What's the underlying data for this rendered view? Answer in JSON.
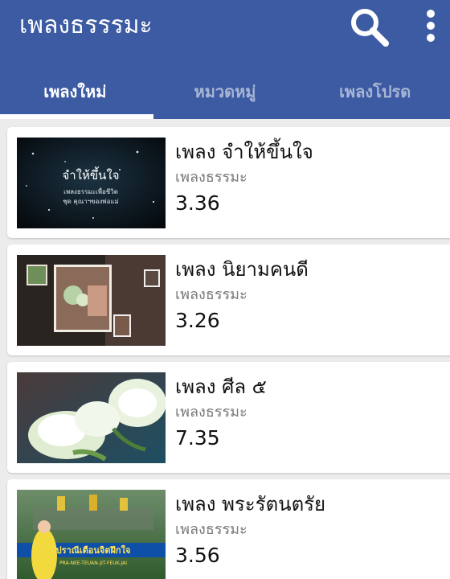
{
  "app": {
    "title": "เพลงธรรรมะ",
    "actions": [
      "search-icon",
      "more-vert-icon"
    ]
  },
  "colors": {
    "appbar": "#3c5ba2",
    "background": "#ececec",
    "card": "#ffffff"
  },
  "tabs": [
    {
      "label": "เพลงใหม่",
      "active": true
    },
    {
      "label": "หมวดหมู่",
      "active": false
    },
    {
      "label": "เพลงโปรด",
      "active": false
    }
  ],
  "songs": [
    {
      "title": "เพลง จำให้ขึ้นใจ",
      "category": "เพลงธรรมะ",
      "duration": "3.36",
      "thumbnail": {
        "title": "จำให้ขึ้นใจ",
        "line1": "เพลงธรรมะเพื่อชีวิต",
        "line2": "ชุด คุณาฯของพ่อแม่"
      }
    },
    {
      "title": "เพลง นิยามคนดี",
      "category": "เพลงธรรมะ",
      "duration": "3.26"
    },
    {
      "title": "เพลง ศีล ๕",
      "category": "เพลงธรรมะ",
      "duration": "7.35"
    },
    {
      "title": "เพลง พระรัตนตรัย",
      "category": "เพลงธรรมะ",
      "duration": "3.56",
      "thumbnail": {
        "banner": "ปราณีเตือนจิตฝึกใจ",
        "subtitle": "PRA-NEE-TEUAN-JIT-FEUK-JAI"
      }
    }
  ]
}
